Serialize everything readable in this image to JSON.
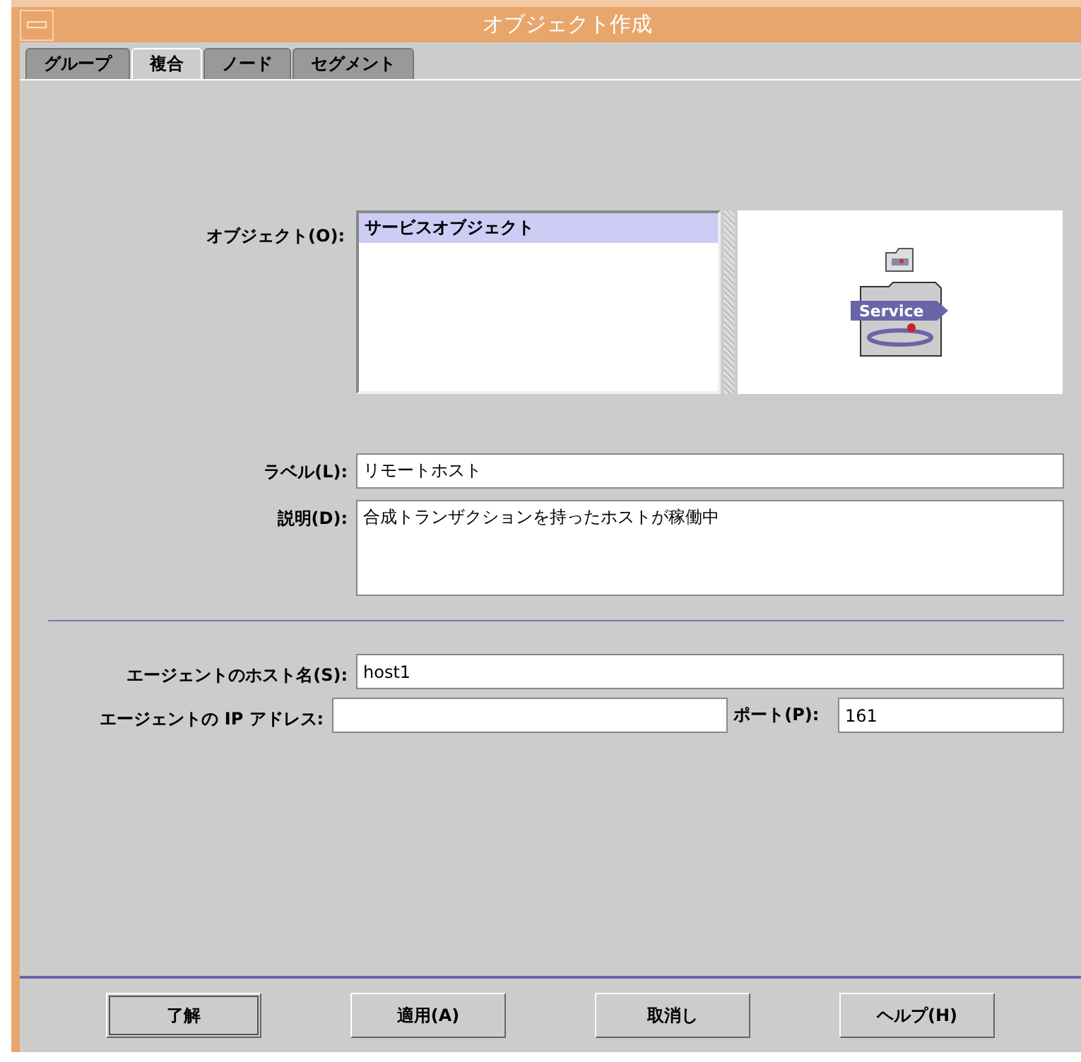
{
  "window": {
    "title": "オブジェクト作成"
  },
  "tabs": [
    {
      "label": "グループ",
      "selected": false
    },
    {
      "label": "複合",
      "selected": true
    },
    {
      "label": "ノード",
      "selected": false
    },
    {
      "label": "セグメント",
      "selected": false
    }
  ],
  "object": {
    "label": "オブジェクト(O):",
    "items": [
      {
        "label": "サービスオブジェクト",
        "selected": true
      }
    ],
    "preview": {
      "caption": "Service"
    }
  },
  "fields": [
    {
      "label": "ラベル(L):",
      "value": "リモートホスト"
    },
    {
      "label": "説明(D):",
      "value": "合成トランザクションを持ったホストが稼働中"
    }
  ],
  "agent": {
    "host": {
      "label": "エージェントのホスト名(S):",
      "value": "host1"
    },
    "ip": {
      "label": "エージェントの IP アドレス:"
    },
    "port": {
      "label": "ポート(P):",
      "value": "161"
    }
  },
  "buttons": [
    {
      "label": "了解",
      "default": true
    },
    {
      "label": "適用(A)",
      "default": false
    },
    {
      "label": "取消し",
      "default": false
    },
    {
      "label": "ヘルプ(H)",
      "default": false
    }
  ]
}
